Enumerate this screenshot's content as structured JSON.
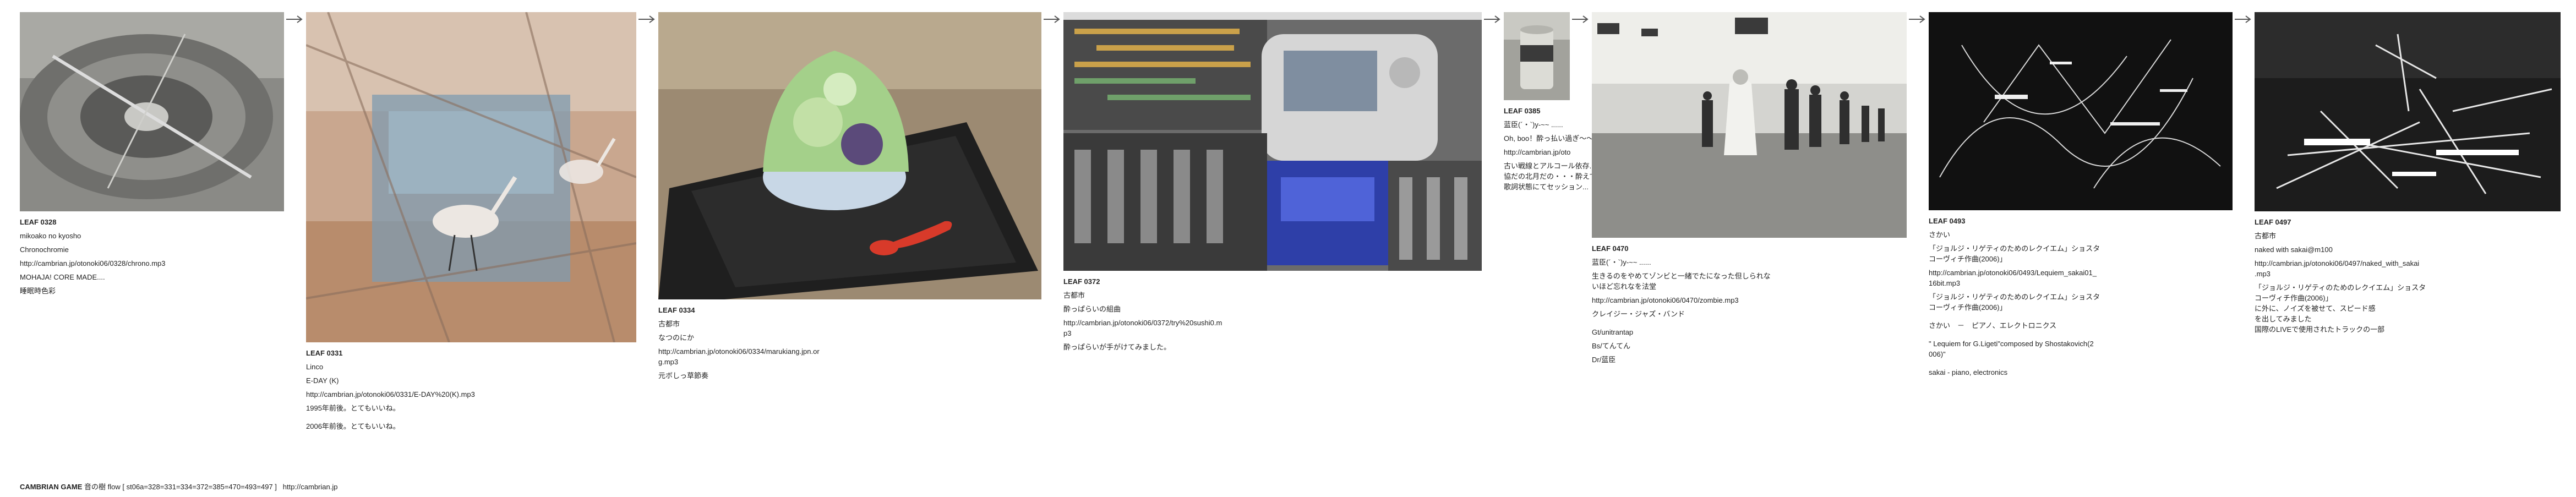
{
  "leaves": [
    {
      "title": "LEAF 0328",
      "lines": [
        "mikoako no kyosho",
        "Chronochromie",
        "http://cambrian.jp/otonoki06/0328/chrono.mp3",
        "MOHAJA! CORE MADE....",
        "睡眠時色彩"
      ]
    },
    {
      "title": "LEAF 0331",
      "lines": [
        "Linco",
        "E-DAY (K)",
        "http://cambrian.jp/otonoki06/0331/E-DAY%20(K).mp3",
        "1995年前後。とてもいいね。",
        "2006年前後。とてもいいね。"
      ]
    },
    {
      "title": "LEAF 0334",
      "lines": [
        "古都市",
        "なつのにか",
        "http://cambrian.jp/otonoki06/0334/marukiang.jpn.or",
        "g.mp3",
        "元ボしっ草節奏"
      ]
    },
    {
      "title": "LEAF 0372",
      "lines": [
        "古都市",
        "酔っぱらいの組曲",
        "http://cambrian.jp/otonoki06/0372/try%20sushi0.m",
        "p3",
        "酔っぱらいが手がけてみました。"
      ]
    },
    {
      "title": "LEAF 0385",
      "lines": [
        "蓝臣(´・`)y-~~ ......",
        "Oh, boo！酔っ払い過ぎ～～",
        "http://cambrian.jp/oto",
        "古い戦線とアルコール依存...",
        "協だの北月だの・・・酔えて",
        "歌詞状態にてセッション..."
      ]
    },
    {
      "title": "LEAF 0470",
      "lines": [
        "蓝臣(´・`)y-~~ ......",
        "生きるのをやめてゾンビと一緒でたになった但しられな",
        "いほど忘れなを法堂",
        "http://cambrian.jp/otonoki06/0470/zombie.mp3",
        "クレイジー・ジャズ・バンド",
        "Gt/unitrantap",
        "Bs/てんてん",
        "Dr/蓝臣"
      ]
    },
    {
      "title": "LEAF 0493",
      "lines": [
        "さかい",
        "「ジョルジ・リゲティのためのレクイエム」ショスタ",
        "コーヴィチ作曲(2006)」",
        "http://cambrian.jp/otonoki06/0493/Lequiem_sakai01_",
        "16bit.mp3",
        "「ジョルジ・リゲティのためのレクイエム」ショスタ",
        "コーヴィチ作曲(2006)」",
        "さかい　－　ピアノ、エレクトロニクス",
        "\" Lequiem for G.Ligeti\"composed by Shostakovich(2",
        "006)\"",
        "sakai - piano, electronics"
      ]
    },
    {
      "title": "LEAF 0497",
      "lines": [
        "古都市",
        "naked with sakai@m100",
        "http://cambrian.jp/otonoki06/0497/naked_with_sakai",
        ".mp3",
        "「ジョルジ・リゲティのためのレクイエム」ショスタ",
        "コーヴィチ作曲(2006)」",
        "に外に、ノイズを被せて、スピード感",
        "を出してみました",
        "国際のLIVEで使用されたトラックの一部"
      ]
    }
  ],
  "footer": {
    "label": "CAMBRIAN GAME",
    "tree": "音の樹",
    "flow": "flow [ st06a=328=331=334=372=385=470=493=497 ]",
    "url": "http://cambrian.jp"
  }
}
